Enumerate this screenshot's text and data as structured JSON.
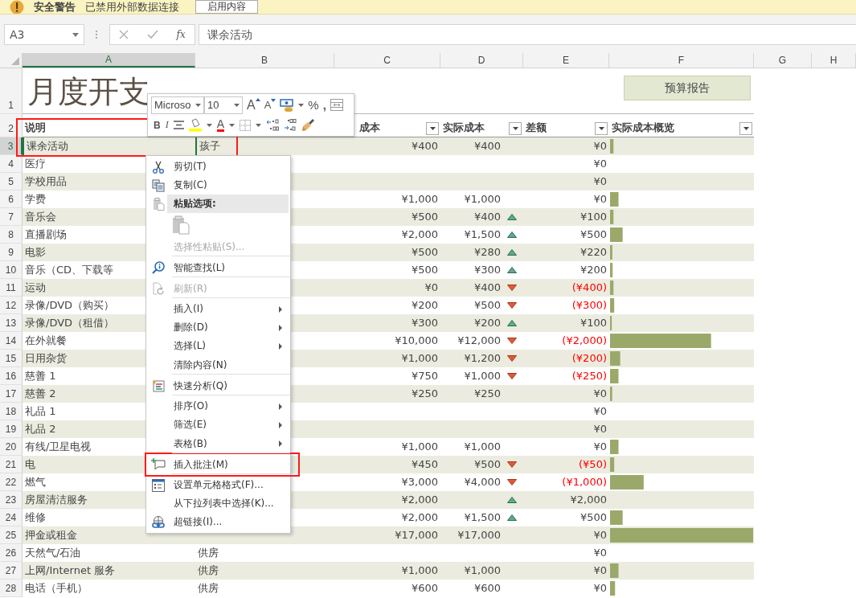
{
  "message_bar": {
    "title": "安全警告",
    "message": "已禁用外部数据连接",
    "button": "启用内容"
  },
  "formula_bar": {
    "name_box": "A3",
    "function_label": "fx",
    "value": "课余活动"
  },
  "columns": [
    {
      "label": "A",
      "selected": true
    },
    {
      "label": "B",
      "selected": false
    },
    {
      "label": "C",
      "selected": false
    },
    {
      "label": "D",
      "selected": false
    },
    {
      "label": "E",
      "selected": false
    },
    {
      "label": "F",
      "selected": false
    },
    {
      "label": "G",
      "selected": false
    },
    {
      "label": "H",
      "selected": false
    }
  ],
  "title_row": {
    "row": "1",
    "title": "月度开支",
    "button": "预算报告"
  },
  "header_row": {
    "row": "2",
    "description": "说明",
    "planned": "成本",
    "actual": "实际成本",
    "difference": "差额",
    "overview": "实际成本概览"
  },
  "rows": [
    {
      "row": "3",
      "selected": true,
      "description": "课余活动",
      "category": "孩子",
      "planned": "¥400",
      "actual": "¥400",
      "kind": "even",
      "difference": "¥0",
      "negative": false,
      "level": 0.024
    },
    {
      "row": "4",
      "selected": false,
      "description": "医疗",
      "kind": "even",
      "difference": "¥0",
      "negative": false
    },
    {
      "row": "5",
      "selected": false,
      "description": "学校用品",
      "kind": "even",
      "difference": "¥0",
      "negative": false
    },
    {
      "row": "6",
      "selected": false,
      "description": "学费",
      "planned": "¥1,000",
      "actual": "¥1,000",
      "kind": "even",
      "difference": "¥0",
      "negative": false,
      "level": 0.059
    },
    {
      "row": "7",
      "selected": false,
      "description": "音乐会",
      "planned": "¥500",
      "actual": "¥400",
      "kind": "under",
      "difference": "¥100",
      "negative": false,
      "level": 0.024
    },
    {
      "row": "8",
      "selected": false,
      "description": "直播剧场",
      "planned": "¥2,000",
      "actual": "¥1,500",
      "kind": "under",
      "difference": "¥500",
      "negative": false,
      "level": 0.088
    },
    {
      "row": "9",
      "selected": false,
      "description": "电影",
      "planned": "¥500",
      "actual": "¥280",
      "kind": "under",
      "difference": "¥220",
      "negative": false,
      "level": 0.016
    },
    {
      "row": "10",
      "selected": false,
      "description": "音乐（CD、下载等",
      "planned": "¥500",
      "actual": "¥300",
      "kind": "under",
      "difference": "¥200",
      "negative": false,
      "level": 0.018
    },
    {
      "row": "11",
      "selected": false,
      "description": "运动",
      "planned": "¥0",
      "actual": "¥400",
      "kind": "over",
      "difference": "(¥400)",
      "negative": true,
      "level": 0.024
    },
    {
      "row": "12",
      "selected": false,
      "description": "录像/DVD（购买）",
      "planned": "¥200",
      "actual": "¥500",
      "kind": "over",
      "difference": "(¥300)",
      "negative": true,
      "level": 0.029
    },
    {
      "row": "13",
      "selected": false,
      "description": "录像/DVD（租借）",
      "planned": "¥300",
      "actual": "¥200",
      "kind": "under",
      "difference": "¥100",
      "negative": false,
      "level": 0.012
    },
    {
      "row": "14",
      "selected": false,
      "description": "在外就餐",
      "planned": "¥10,000",
      "actual": "¥12,000",
      "kind": "over",
      "difference": "(¥2,000)",
      "negative": true,
      "level": 0.706
    },
    {
      "row": "15",
      "selected": false,
      "description": "日用杂货",
      "planned": "¥1,000",
      "actual": "¥1,200",
      "kind": "over",
      "difference": "(¥200)",
      "negative": true,
      "level": 0.071
    },
    {
      "row": "16",
      "selected": false,
      "description": "慈善 1",
      "planned": "¥750",
      "actual": "¥1,000",
      "kind": "over",
      "difference": "(¥250)",
      "negative": true,
      "level": 0.059
    },
    {
      "row": "17",
      "selected": false,
      "description": "慈善 2",
      "planned": "¥250",
      "actual": "¥250",
      "kind": "even",
      "difference": "¥0",
      "negative": false,
      "level": 0.015
    },
    {
      "row": "18",
      "selected": false,
      "description": "礼品 1",
      "kind": "even",
      "difference": "¥0",
      "negative": false
    },
    {
      "row": "19",
      "selected": false,
      "description": "礼品 2",
      "kind": "even",
      "difference": "¥0",
      "negative": false
    },
    {
      "row": "20",
      "selected": false,
      "description": "有线/卫星电视",
      "planned": "¥1,000",
      "actual": "¥1,000",
      "kind": "even",
      "difference": "¥0",
      "negative": false,
      "level": 0.059
    },
    {
      "row": "21",
      "selected": false,
      "description": "电",
      "planned": "¥450",
      "actual": "¥500",
      "kind": "over",
      "difference": "(¥50)",
      "negative": true,
      "level": 0.029
    },
    {
      "row": "22",
      "selected": false,
      "description": "燃气",
      "planned": "¥3,000",
      "actual": "¥4,000",
      "kind": "over",
      "difference": "(¥1,000)",
      "negative": true,
      "level": 0.235
    },
    {
      "row": "23",
      "selected": false,
      "description": "房屋清洁服务",
      "planned": "¥2,000",
      "kind": "under",
      "difference": "¥2,000",
      "negative": false
    },
    {
      "row": "24",
      "selected": false,
      "description": "维修",
      "planned": "¥2,000",
      "actual": "¥1,500",
      "kind": "under",
      "difference": "¥500",
      "negative": false,
      "level": 0.088
    },
    {
      "row": "25",
      "selected": false,
      "description": "押金或租金",
      "planned": "¥17,000",
      "actual": "¥17,000",
      "kind": "even",
      "difference": "¥0",
      "negative": false,
      "level": 1
    },
    {
      "row": "26",
      "selected": false,
      "description": "天然气/石油",
      "category": "供房",
      "kind": "even",
      "difference": "¥0",
      "negative": false
    },
    {
      "row": "27",
      "selected": false,
      "description": "上网/Internet 服务",
      "category": "供房",
      "planned": "¥1,000",
      "actual": "¥1,000",
      "kind": "even",
      "difference": "¥0",
      "negative": false,
      "level": 0.059
    },
    {
      "row": "28",
      "selected": false,
      "description": "电话（手机）",
      "category": "供房",
      "planned": "¥600",
      "actual": "¥600",
      "kind": "even",
      "difference": "¥0",
      "negative": false,
      "level": 0.035
    }
  ],
  "mini_toolbar": {
    "font": "Microso",
    "size": "10",
    "grow_font": "A",
    "shrink_font": "A",
    "percent": "%",
    "comma": ",",
    "bold": "B",
    "italic": "I",
    "font_color": "A"
  },
  "context_menu": [
    {
      "kind": "cut",
      "label": "剪切(T)",
      "disabled": false,
      "submenu": false,
      "separator_after": false
    },
    {
      "kind": "copy",
      "label": "复制(C)",
      "disabled": false,
      "submenu": false,
      "separator_after": false
    },
    {
      "kind": "paste-header",
      "label": "粘贴选项:",
      "disabled": false,
      "submenu": false,
      "separator_after": false
    },
    {
      "kind": "paste-options"
    },
    {
      "kind": "plain",
      "label": "选择性粘贴(S)...",
      "disabled": true,
      "submenu": false,
      "separator_after": true
    },
    {
      "kind": "lookup",
      "label": "智能查找(L)",
      "disabled": false,
      "submenu": false,
      "separator_after": true
    },
    {
      "kind": "refresh",
      "label": "刷新(R)",
      "disabled": true,
      "submenu": false,
      "separator_after": true
    },
    {
      "kind": "plain",
      "label": "插入(I)",
      "disabled": false,
      "submenu": true,
      "separator_after": false
    },
    {
      "kind": "plain",
      "label": "删除(D)",
      "disabled": false,
      "submenu": true,
      "separator_after": false
    },
    {
      "kind": "plain",
      "label": "选择(L)",
      "disabled": false,
      "submenu": true,
      "separator_after": false
    },
    {
      "kind": "plain",
      "label": "清除内容(N)",
      "disabled": false,
      "submenu": false,
      "separator_after": true
    },
    {
      "kind": "analysis",
      "label": "快速分析(Q)",
      "disabled": false,
      "submenu": false,
      "separator_after": true
    },
    {
      "kind": "plain",
      "label": "排序(O)",
      "disabled": false,
      "submenu": true,
      "separator_after": false
    },
    {
      "kind": "plain",
      "label": "筛选(E)",
      "disabled": false,
      "submenu": true,
      "separator_after": false
    },
    {
      "kind": "plain",
      "label": "表格(B)",
      "disabled": false,
      "submenu": true,
      "separator_after": true
    },
    {
      "kind": "comment",
      "label": "插入批注(M)",
      "disabled": false,
      "submenu": false,
      "separator_after": true
    },
    {
      "kind": "format",
      "label": "设置单元格格式(F)...",
      "disabled": false,
      "submenu": false,
      "separator_after": false
    },
    {
      "kind": "plain",
      "label": "从下拉列表中选择(K)...",
      "disabled": false,
      "submenu": false,
      "separator_after": false
    },
    {
      "kind": "link",
      "label": "超链接(I)...",
      "disabled": false,
      "submenu": false,
      "separator_after": false
    }
  ]
}
